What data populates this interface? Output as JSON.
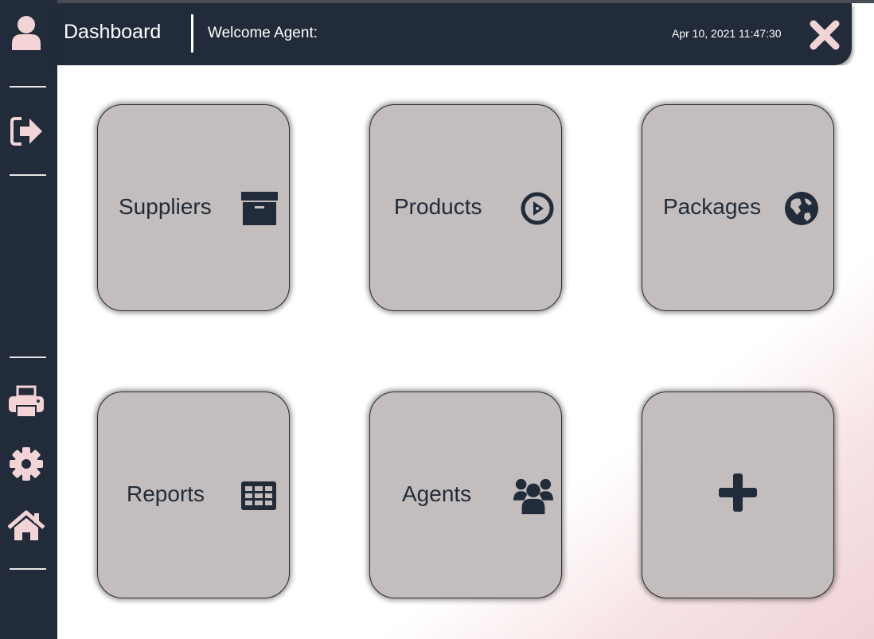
{
  "header": {
    "title": "Dashboard",
    "welcome": "Welcome Agent:",
    "datetime": "Apr 10, 2021 11:47:30",
    "close_icon": "close-icon"
  },
  "sidebar": {
    "items": [
      {
        "name": "user",
        "icon": "user-icon"
      },
      {
        "name": "logout",
        "icon": "sign-out-icon"
      },
      {
        "name": "print",
        "icon": "printer-icon"
      },
      {
        "name": "settings",
        "icon": "gear-icon"
      },
      {
        "name": "home",
        "icon": "home-icon"
      }
    ]
  },
  "tiles": [
    {
      "label": "Suppliers",
      "icon": "archive-box-icon"
    },
    {
      "label": "Products",
      "icon": "compass-icon"
    },
    {
      "label": "Packages",
      "icon": "globe-icon"
    },
    {
      "label": "Reports",
      "icon": "table-grid-icon"
    },
    {
      "label": "Agents",
      "icon": "users-icon"
    },
    {
      "label": "",
      "icon": "plus-icon"
    }
  ],
  "colors": {
    "navy": "#222b39",
    "accent_pink": "#f2d4d6",
    "tile_gray": "#c3bdbd"
  }
}
